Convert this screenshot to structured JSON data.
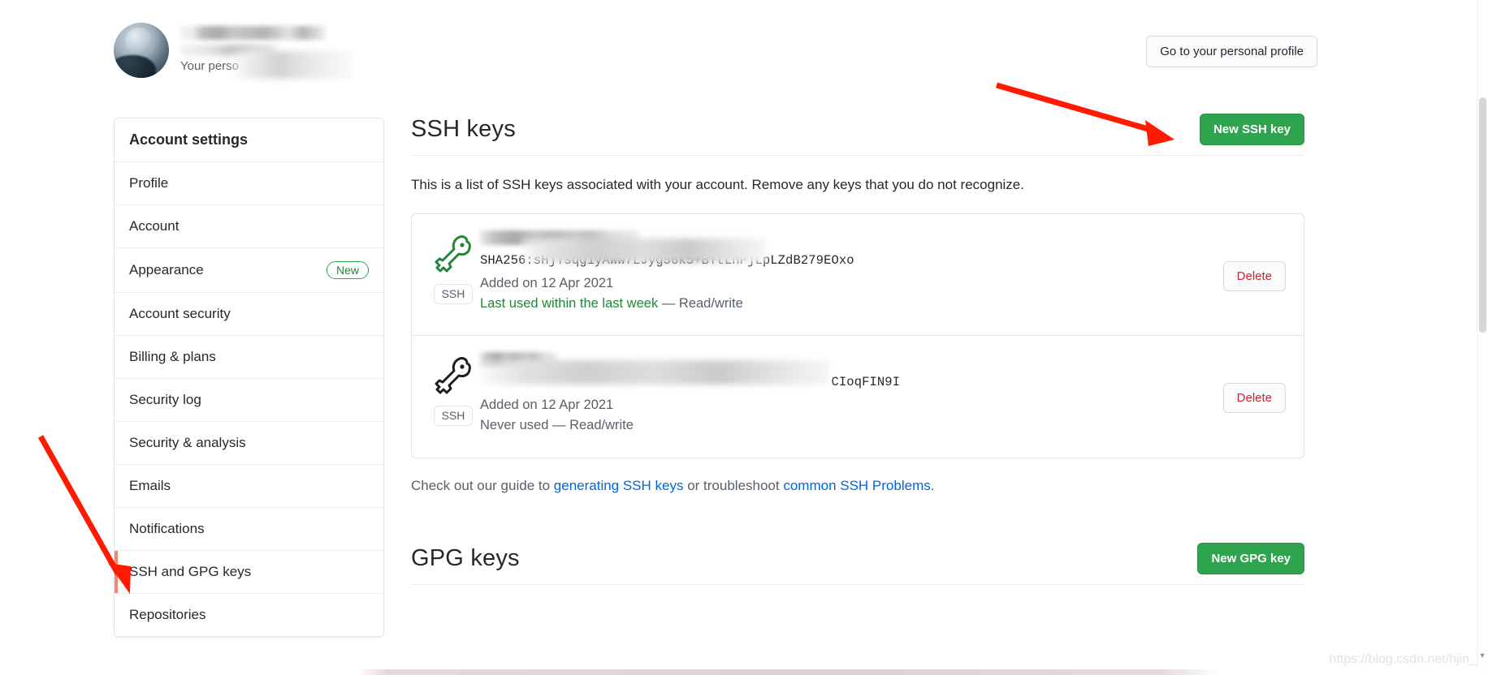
{
  "header": {
    "avatar_alt": "user-avatar",
    "name_redacted": true,
    "subtitle_visible_text": "Your perso",
    "personal_profile_button": "Go to your personal profile"
  },
  "sidebar": {
    "title": "Account settings",
    "items": [
      {
        "label": "Profile",
        "badge": "",
        "selected": false
      },
      {
        "label": "Account",
        "badge": "",
        "selected": false
      },
      {
        "label": "Appearance",
        "badge": "New",
        "selected": false
      },
      {
        "label": "Account security",
        "badge": "",
        "selected": false
      },
      {
        "label": "Billing & plans",
        "badge": "",
        "selected": false
      },
      {
        "label": "Security log",
        "badge": "",
        "selected": false
      },
      {
        "label": "Security & analysis",
        "badge": "",
        "selected": false
      },
      {
        "label": "Emails",
        "badge": "",
        "selected": false
      },
      {
        "label": "Notifications",
        "badge": "",
        "selected": false
      },
      {
        "label": "SSH and GPG keys",
        "badge": "",
        "selected": true
      },
      {
        "label": "Repositories",
        "badge": "",
        "selected": false
      }
    ]
  },
  "ssh_section": {
    "title": "SSH keys",
    "new_key_button": "New SSH key",
    "description": "This is a list of SSH keys associated with your account. Remove any keys that you do not recognize.",
    "keys": [
      {
        "title_redacted": true,
        "icon": "key-icon-active",
        "badge": "SSH",
        "fingerprint": "SHA256:sHjTsqg1yAWw7LJyg56k5+BYtLnPjLpLZdB279EOxo",
        "fingerprint_visible_prefix": "SHA256:",
        "fingerprint_visible_suffix": "yg56k5+BYtLnPjLpLZdB279EOxo",
        "added": "Added on 12 Apr 2021",
        "last_used": "Last used within the last week",
        "permission": "— Read/write",
        "delete_button": "Delete"
      },
      {
        "title_redacted": true,
        "icon": "key-icon-inactive",
        "badge": "SSH",
        "fingerprint": "SHA256:CIoqFIN9I",
        "fingerprint_visible_prefix": "",
        "fingerprint_visible_suffix": "CIoqFIN9I",
        "added": "Added on 12 Apr 2021",
        "last_used": "Never used",
        "permission": "— Read/write",
        "delete_button": "Delete"
      }
    ],
    "footnote": {
      "before": "Check out our guide to ",
      "link1": "generating SSH keys",
      "middle": " or troubleshoot ",
      "link2": "common SSH Problems",
      "after": "."
    }
  },
  "gpg_section": {
    "title": "GPG keys",
    "new_key_button": "New GPG key"
  },
  "annotations": {
    "arrow_color": "#ff1a00",
    "arrow_1_target": "New SSH key button",
    "arrow_2_target": "SSH and GPG keys sidebar item"
  },
  "watermark": "https://blog.csdn.net/hjin_",
  "colors": {
    "accent_green": "#2ea44f",
    "link_blue": "#0366d6",
    "danger_red": "#cb2431",
    "selected_border": "#f9826c",
    "text_primary": "#24292e",
    "text_muted": "#586069",
    "success_green": "#22863a"
  }
}
